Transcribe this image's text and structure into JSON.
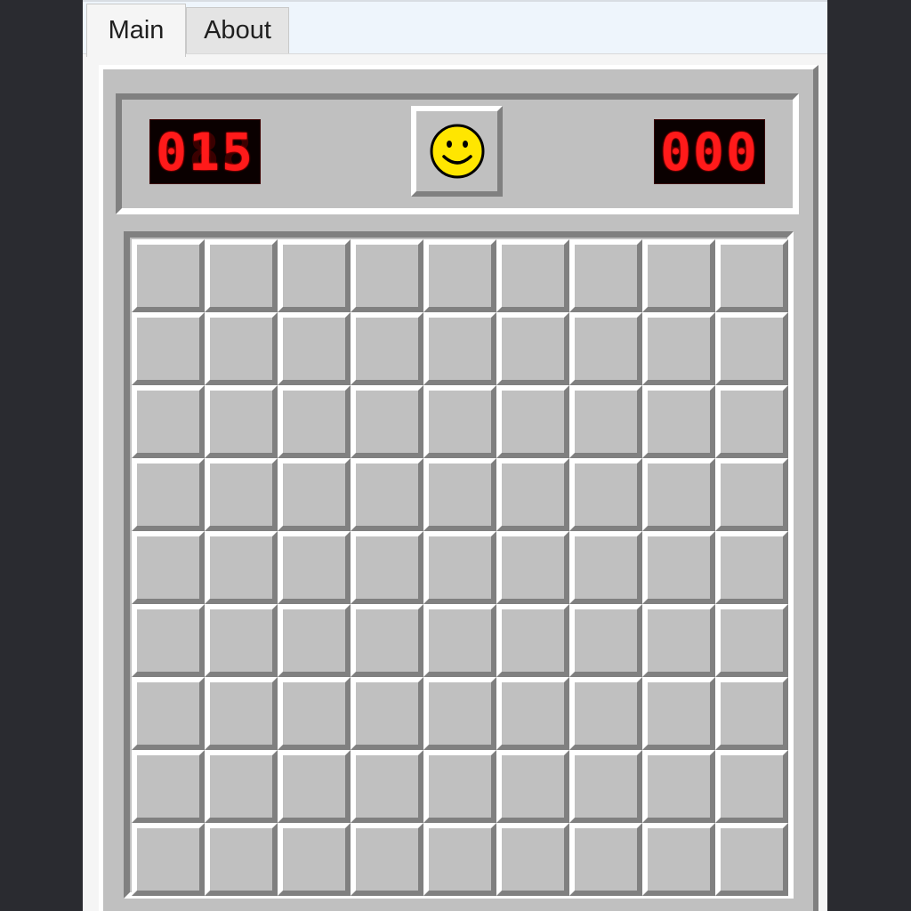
{
  "tabs": [
    {
      "label": "Main",
      "active": true
    },
    {
      "label": "About",
      "active": false
    }
  ],
  "game": {
    "mines_remaining": "015",
    "timer": "000",
    "face": "smiley-face-icon",
    "rows": 9,
    "cols": 9,
    "cell_state": "unrevealed"
  },
  "colors": {
    "panel": "#c0c0c0",
    "lcd_on": "#ff1a1a",
    "lcd_bg": "#0a0000",
    "face": "#ffe600",
    "highlight": "#ffffff",
    "shadow": "#808080"
  }
}
